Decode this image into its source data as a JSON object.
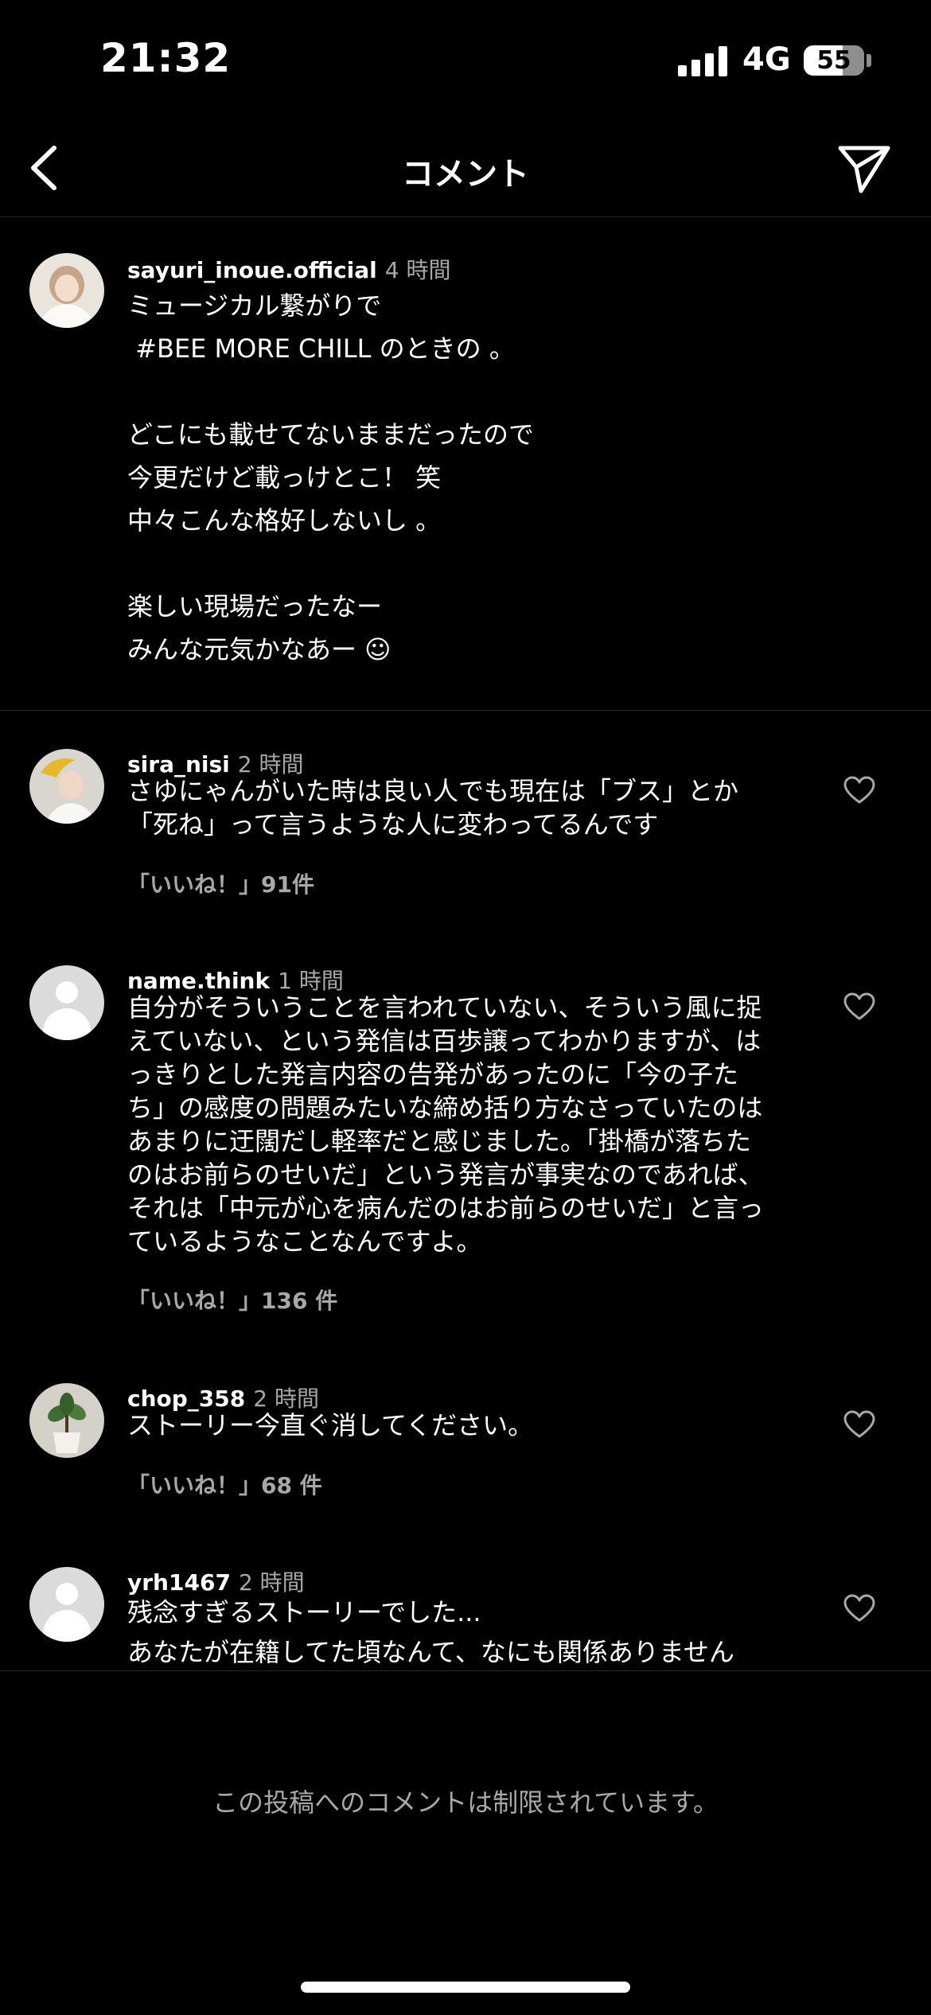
{
  "status_bar": {
    "time": "21:32",
    "network": "4G",
    "battery": "55",
    "battery_level": 0.55
  },
  "header": {
    "title": "コメント",
    "back_icon": "chevron-left-icon",
    "send_icon": "paper-plane-icon"
  },
  "caption": {
    "username": "sayuri_inoue.official",
    "time": "4 時間",
    "lines": [
      "ミュージカル繋がりで",
      " #BEE MORE CHILL のときの 。",
      "",
      "どこにも載せてないままだったので",
      "今更だけど載っけとこ！ 笑",
      "中々こんな格好しないし 。",
      "",
      "楽しい現場だったなー",
      "みんな元気かなあー ☺"
    ]
  },
  "comments": [
    {
      "username": "sira_nisi",
      "time": "2 時間",
      "lines": [
        "さゆにゃんがいた時は良い人でも現在は「ブス」とか",
        "「死ね」って言うような人に変わってるんです"
      ],
      "likes": "「いいね！」91件"
    },
    {
      "username": "name.think",
      "time": "1 時間",
      "lines": [
        "自分がそういうことを言われていない、そういう風に捉",
        "えていない、という発信は百歩譲ってわかりますが、は",
        "っきりとした発言内容の告発があったのに「今の子た",
        "ち」の感度の問題みたいな締め括り方なさっていたのは",
        "あまりに迂闊だし軽率だと感じました。「掛橋が落ちた",
        "のはお前らのせいだ」という発言が事実なのであれば、",
        "それは「中元が心を病んだのはお前らのせいだ」と言っ",
        "ているようなことなんですよ。"
      ],
      "likes": "「いいね！」136 件"
    },
    {
      "username": "chop_358",
      "time": "2 時間",
      "lines": [
        "ストーリー今直ぐ消してください。"
      ],
      "likes": "「いいね！」68 件"
    },
    {
      "username": "yrh1467",
      "time": "2 時間",
      "lines": [
        "残念すぎるストーリーでした...",
        "あなたが在籍してた頃なんて、なにも関係ありません"
      ],
      "likes": ""
    }
  ],
  "footer": {
    "restricted_text": "この投稿へのコメントは制限されています。"
  }
}
